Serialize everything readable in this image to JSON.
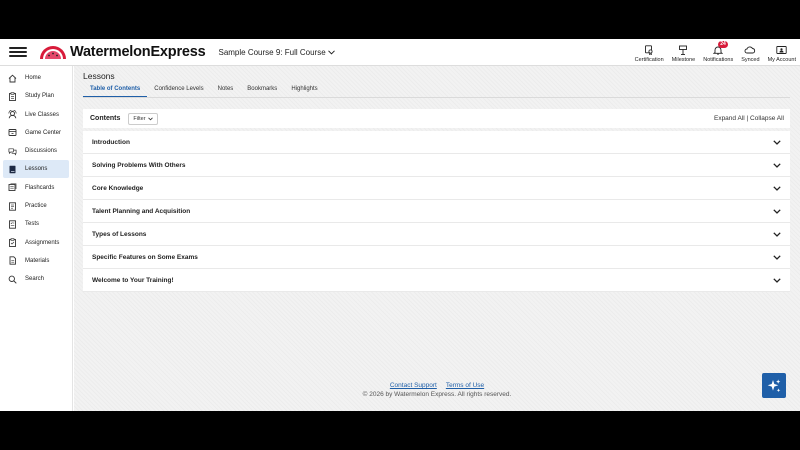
{
  "header": {
    "logo_text": "WatermelonExpress",
    "course_name": "Sample Course 9: Full Course",
    "actions": [
      {
        "label": "Certification",
        "icon": "certificate-icon"
      },
      {
        "label": "Milestone",
        "icon": "milestone-icon"
      },
      {
        "label": "Notifications",
        "icon": "bell-icon",
        "badge": "24"
      },
      {
        "label": "Synced",
        "icon": "cloud-icon"
      },
      {
        "label": "My Account",
        "icon": "account-card-icon"
      }
    ]
  },
  "sidebar": {
    "items": [
      {
        "label": "Home",
        "icon": "home-icon"
      },
      {
        "label": "Study Plan",
        "icon": "study-plan-icon"
      },
      {
        "label": "Live Classes",
        "icon": "live-classes-icon"
      },
      {
        "label": "Game Center",
        "icon": "game-center-icon"
      },
      {
        "label": "Discussions",
        "icon": "discussions-icon"
      },
      {
        "label": "Lessons",
        "icon": "lessons-icon",
        "active": true
      },
      {
        "label": "Flashcards",
        "icon": "flashcards-icon"
      },
      {
        "label": "Practice",
        "icon": "practice-icon"
      },
      {
        "label": "Tests",
        "icon": "tests-icon"
      },
      {
        "label": "Assignments",
        "icon": "assignments-icon"
      },
      {
        "label": "Materials",
        "icon": "materials-icon"
      },
      {
        "label": "Search",
        "icon": "search-icon"
      }
    ]
  },
  "main": {
    "title": "Lessons",
    "tabs": [
      {
        "label": "Table of Contents",
        "active": true
      },
      {
        "label": "Confidence Levels"
      },
      {
        "label": "Notes"
      },
      {
        "label": "Bookmarks"
      },
      {
        "label": "Highlights"
      }
    ],
    "contents_label": "Contents",
    "filter_label": "Filter",
    "expand_all": "Expand All",
    "separator": "|",
    "collapse_all": "Collapse All",
    "toc": [
      "Introduction",
      "Solving Problems With Others",
      "Core Knowledge",
      "Talent Planning and Acquisition",
      "Types of Lessons",
      "Specific Features on Some Exams",
      "Welcome to Your Training!"
    ]
  },
  "footer": {
    "contact": "Contact Support",
    "terms": "Terms of Use",
    "copyright": "© 2026 by Watermelon Express. All rights reserved."
  },
  "colors": {
    "accent": "#1f5fa8",
    "active_nav_bg": "#dde9f7",
    "badge": "#d81b3a",
    "logo_red": "#d81b3a"
  }
}
